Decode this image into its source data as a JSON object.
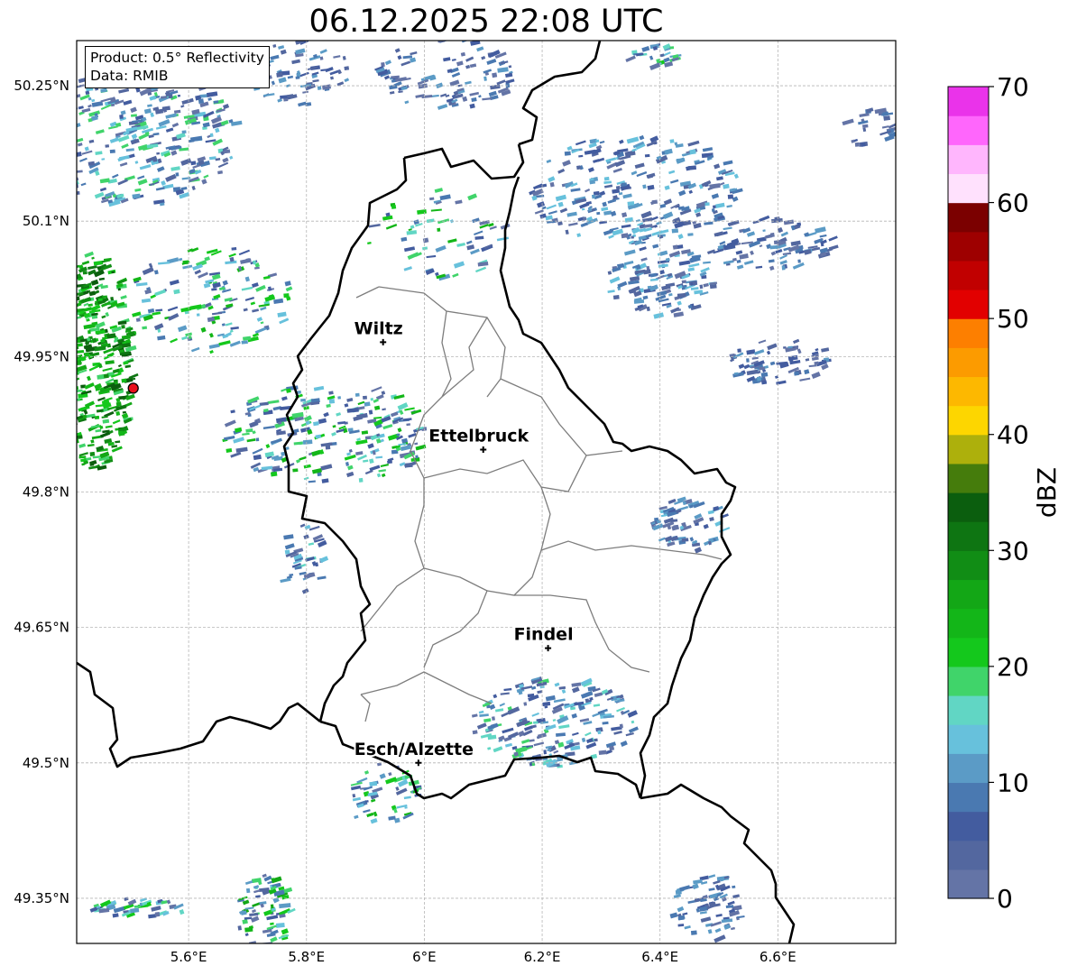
{
  "title": "06.12.2025 22:08 UTC",
  "info": {
    "product": "Product: 0.5° Reflectivity",
    "data": "Data: RMIB"
  },
  "lat_ticks": [
    {
      "value": 50.25,
      "label": "50.25°N"
    },
    {
      "value": 50.1,
      "label": "50.1°N"
    },
    {
      "value": 49.95,
      "label": "49.95°N"
    },
    {
      "value": 49.8,
      "label": "49.8°N"
    },
    {
      "value": 49.65,
      "label": "49.65°N"
    },
    {
      "value": 49.5,
      "label": "49.5°N"
    },
    {
      "value": 49.35,
      "label": "49.35°N"
    }
  ],
  "lon_ticks": [
    {
      "value": 5.6,
      "label": "5.6°E"
    },
    {
      "value": 5.8,
      "label": "5.8°E"
    },
    {
      "value": 6.0,
      "label": "6°E"
    },
    {
      "value": 6.2,
      "label": "6.2°E"
    },
    {
      "value": 6.4,
      "label": "6.4°E"
    },
    {
      "value": 6.6,
      "label": "6.6°E"
    }
  ],
  "extent": {
    "lon": [
      5.41,
      6.8
    ],
    "lat": [
      49.3,
      50.3
    ]
  },
  "cities": [
    {
      "name": "Wiltz",
      "lon": 5.93,
      "lat": 49.966
    },
    {
      "name": "Ettelbruck",
      "lon": 6.1,
      "lat": 49.847
    },
    {
      "name": "Findel",
      "lon": 6.21,
      "lat": 49.627
    },
    {
      "name": "Esch/Alzette",
      "lon": 5.99,
      "lat": 49.5
    }
  ],
  "radar_site": {
    "lon": 5.506,
    "lat": 49.915,
    "color": "#e8101c"
  },
  "colorbar": {
    "label": "dBZ",
    "min": 0,
    "max": 70,
    "ticks": [
      {
        "value": 0,
        "label": "0"
      },
      {
        "value": 10,
        "label": "10"
      },
      {
        "value": 20,
        "label": "20"
      },
      {
        "value": 30,
        "label": "30"
      },
      {
        "value": 40,
        "label": "40"
      },
      {
        "value": 50,
        "label": "50"
      },
      {
        "value": 60,
        "label": "60"
      },
      {
        "value": 70,
        "label": "70"
      }
    ],
    "colors": [
      "#6474a6",
      "#53679f",
      "#435c9f",
      "#4a79b1",
      "#5b9bc6",
      "#67c1dc",
      "#61d6c4",
      "#40d46a",
      "#14c81c",
      "#13b618",
      "#13a716",
      "#118d15",
      "#0e7512",
      "#0b5e0e",
      "#457c0c",
      "#adb00c",
      "#fdd600",
      "#fdb800",
      "#fc9b00",
      "#fd7f00",
      "#e20000",
      "#c10000",
      "#9e0000",
      "#7b0000",
      "#ffe1fd",
      "#ffb6fd",
      "#ff66fc",
      "#ea33ea"
    ]
  }
}
